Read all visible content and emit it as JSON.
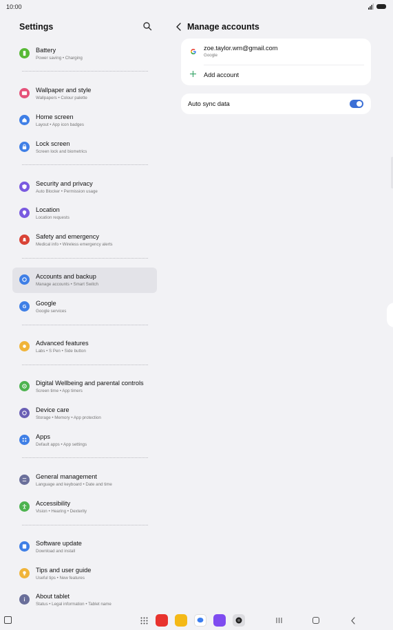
{
  "status_bar": {
    "time": "10:00"
  },
  "left_panel": {
    "title": "Settings",
    "items": [
      {
        "title": "Battery",
        "subtitle": "Power saving  •  Charging",
        "icon": "battery-icon",
        "color": "#58b936"
      },
      {
        "title": "Wallpaper and style",
        "subtitle": "Wallpapers  •  Colour palette",
        "icon": "wallpaper-icon",
        "color": "#e5527a"
      },
      {
        "title": "Home screen",
        "subtitle": "Layout  •  App icon badges",
        "icon": "home-icon",
        "color": "#3f7fe6"
      },
      {
        "title": "Lock screen",
        "subtitle": "Screen lock and biometrics",
        "icon": "lock-icon",
        "color": "#3f7fe6"
      },
      {
        "title": "Security and privacy",
        "subtitle": "Auto Blocker  •  Permission usage",
        "icon": "shield-icon",
        "color": "#7a5ae0"
      },
      {
        "title": "Location",
        "subtitle": "Location requests",
        "icon": "location-pin-icon",
        "color": "#7a5ae0"
      },
      {
        "title": "Safety and emergency",
        "subtitle": "Medical info  •  Wireless emergency alerts",
        "icon": "alert-bell-icon",
        "color": "#d94336"
      },
      {
        "title": "Accounts and backup",
        "subtitle": "Manage accounts  •  Smart Switch",
        "icon": "sync-icon",
        "color": "#3f7fe6"
      },
      {
        "title": "Google",
        "subtitle": "Google services",
        "icon": "google-icon",
        "color": "#3f7fe6"
      },
      {
        "title": "Advanced features",
        "subtitle": "Labs  •  S Pen  •  Side button",
        "icon": "gear-plus-icon",
        "color": "#f0b43a"
      },
      {
        "title": "Digital Wellbeing and parental controls",
        "subtitle": "Screen time  •  App timers",
        "icon": "wellbeing-icon",
        "color": "#4db34f"
      },
      {
        "title": "Device care",
        "subtitle": "Storage  •  Memory  •  App protection",
        "icon": "device-care-icon",
        "color": "#6a5fb5"
      },
      {
        "title": "Apps",
        "subtitle": "Default apps  •  App settings",
        "icon": "apps-grid-icon",
        "color": "#3f7fe6"
      },
      {
        "title": "General management",
        "subtitle": "Language and keyboard  •  Date and time",
        "icon": "sliders-icon",
        "color": "#6a6f9a"
      },
      {
        "title": "Accessibility",
        "subtitle": "Vision  •  Hearing  •  Dexterity",
        "icon": "accessibility-icon",
        "color": "#4db34f"
      },
      {
        "title": "Software update",
        "subtitle": "Download and install",
        "icon": "update-icon",
        "color": "#3f7fe6"
      },
      {
        "title": "Tips and user guide",
        "subtitle": "Useful tips  •  New features",
        "icon": "lightbulb-icon",
        "color": "#f0b43a"
      },
      {
        "title": "About tablet",
        "subtitle": "Status  •  Legal information  •  Tablet name",
        "icon": "info-icon",
        "color": "#6a6f9a"
      }
    ]
  },
  "right_panel": {
    "title": "Manage accounts",
    "account": {
      "email": "zoe.taylor.wm@gmail.com",
      "type": "Google"
    },
    "add_account_label": "Add account",
    "auto_sync_label": "Auto sync data",
    "auto_sync_on": true
  },
  "colors": {
    "accent": "#3b6fd6",
    "active_item_bg": "#e3e3e8",
    "background": "#f2f2f5"
  }
}
